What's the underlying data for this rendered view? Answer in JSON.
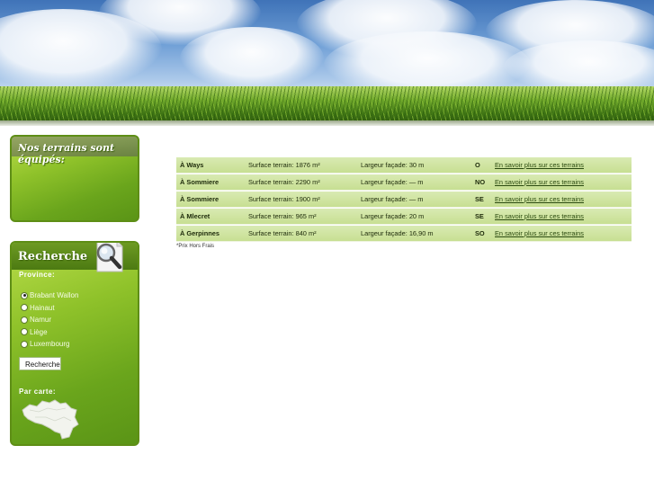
{
  "sidebar": {
    "equip_box": {
      "title": "Nos terrains sont équipés:"
    },
    "search_box": {
      "title": "Recherche",
      "province_label": "Province:",
      "provinces": [
        {
          "label": "Brabant Wallon",
          "checked": true
        },
        {
          "label": "Hainaut",
          "checked": false
        },
        {
          "label": "Namur",
          "checked": false
        },
        {
          "label": "Liège",
          "checked": false
        },
        {
          "label": "Luxembourg",
          "checked": false
        }
      ],
      "button_label": "Recherche",
      "map_label": "Par carte:"
    }
  },
  "listing": {
    "rows": [
      {
        "town": "À Ways",
        "surface": "Surface terrain: 1876 m²",
        "facade": "Largeur façade: 30 m",
        "orientation": "O",
        "link": "En savoir plus sur ces terrains"
      },
      {
        "town": "À Sommiere",
        "surface": "Surface terrain: 2290 m²",
        "facade": "Largeur façade: — m",
        "orientation": "NO",
        "link": "En savoir plus sur ces terrains"
      },
      {
        "town": "À Sommiere",
        "surface": "Surface terrain: 1900 m²",
        "facade": "Largeur façade: — m",
        "orientation": "SE",
        "link": "En savoir plus sur ces terrains"
      },
      {
        "town": "À Mlecret",
        "surface": "Surface terrain: 965 m²",
        "facade": "Largeur façade: 20 m",
        "orientation": "SE",
        "link": "En savoir plus sur ces terrains"
      },
      {
        "town": "À Gerpinnes",
        "surface": "Surface terrain: 840 m²",
        "facade": "Largeur façade: 16,90 m",
        "orientation": "SO",
        "link": "En savoir plus sur ces terrains"
      }
    ],
    "note": "*Prix Hors Frais"
  },
  "colors": {
    "accent_green": "#7ab829",
    "row_bg": "#d3e6a6",
    "link": "#2b4a10"
  }
}
